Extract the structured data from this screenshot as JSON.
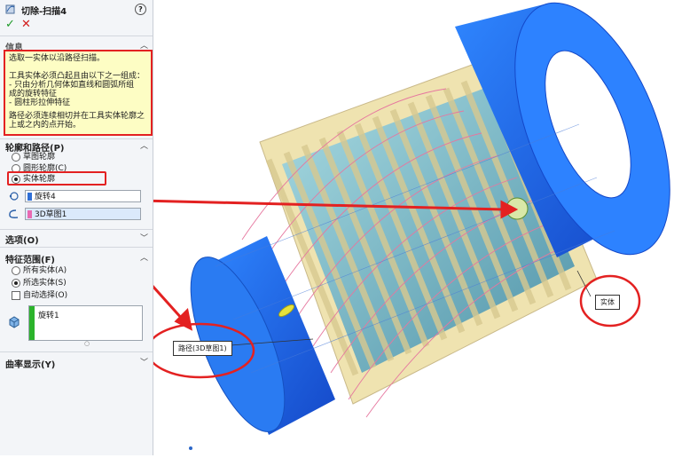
{
  "panel": {
    "title": "切除-扫描4",
    "help_label": "?",
    "ok_label": "✓",
    "cancel_label": "✕",
    "info": {
      "header": "信息",
      "line1": "选取一实体以沿路径扫描。",
      "line2": "工具实体必须凸起且由以下之一组成：",
      "line3": "  - 只由分析几何体如直线和圆弧所组",
      "line4": "成的旋转特征",
      "line5": "  - 圆柱形拉伸特征",
      "line6": "路径必须连续相切并在工具实体轮廓之",
      "line7": "上或之内的点开始。"
    },
    "profile_path": {
      "header": "轮廓和路径(P)",
      "options": [
        "草图轮廓",
        "圆形轮廓(C)",
        "实体轮廓"
      ],
      "selected_index": 2,
      "profile_value": "旋转4",
      "path_value": "3D草图1"
    },
    "options_header": "选项(O)",
    "feature_scope": {
      "header": "特征范围(F)",
      "all_bodies": "所有实体(A)",
      "selected_bodies": "所选实体(S)",
      "auto_select": "自动选择(O)",
      "body_item": "旋转1"
    },
    "curvature_header": "曲率显示(Y)"
  },
  "viewport": {
    "callout_body": "实体",
    "callout_path": "路径(3D草图1)"
  },
  "colors": {
    "accent_red": "#e32121",
    "cylinder_blue": "#1c63e6",
    "thread_cream": "#efe3b0",
    "core_teal": "#6fb3c4"
  }
}
